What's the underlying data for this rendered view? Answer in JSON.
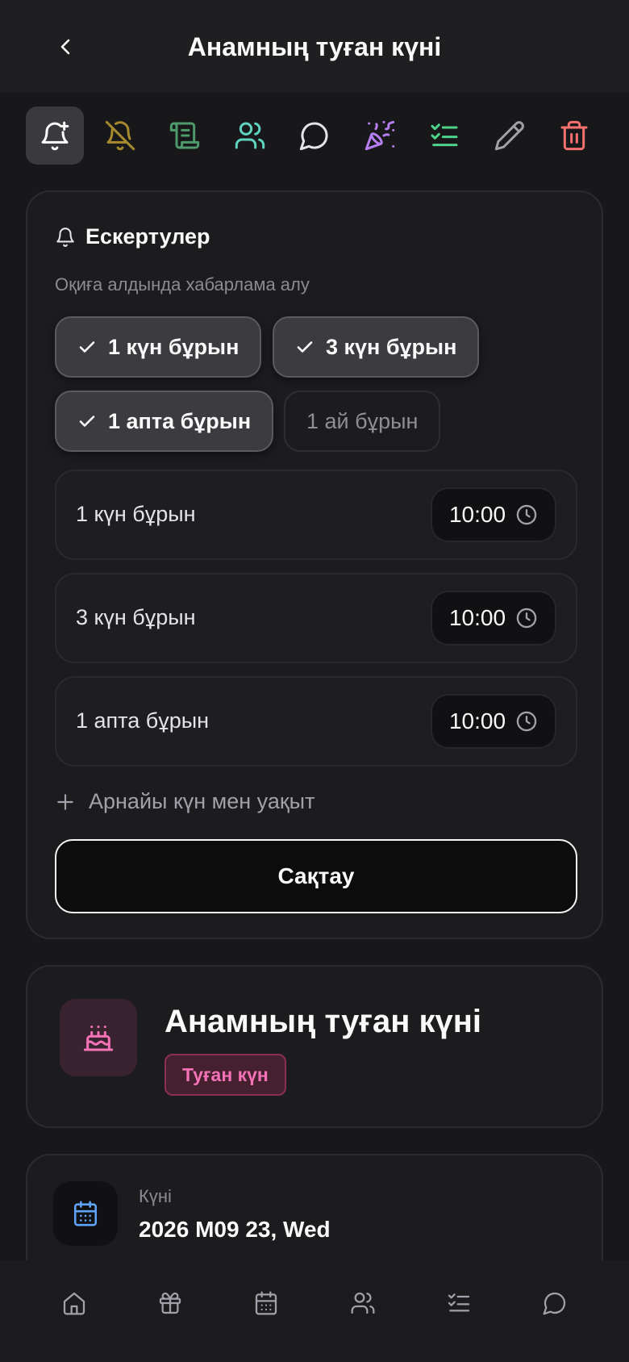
{
  "header": {
    "title": "Анамның туған күні",
    "back_icon": "chevron-left-icon"
  },
  "toolbar": {
    "tools": [
      {
        "name": "bell-plus-icon",
        "color": "#ffffff",
        "active": true
      },
      {
        "name": "bell-off-icon",
        "color": "#a88a2e"
      },
      {
        "name": "scroll-icon",
        "color": "#4e9a6a"
      },
      {
        "name": "users-icon",
        "color": "#5fd3c0"
      },
      {
        "name": "chat-icon",
        "color": "#e4e4e7"
      },
      {
        "name": "party-popper-icon",
        "color": "#b67ef0"
      },
      {
        "name": "checklist-icon",
        "color": "#4ed38a"
      },
      {
        "name": "pencil-icon",
        "color": "#a1a1aa"
      },
      {
        "name": "trash-icon",
        "color": "#f87171"
      }
    ]
  },
  "reminders": {
    "title": "Ескертулер",
    "subtitle": "Оқиға алдында хабарлама алу",
    "chips": [
      {
        "label": "1 күн бұрын",
        "selected": true
      },
      {
        "label": "3 күн бұрын",
        "selected": true
      },
      {
        "label": "1 апта бұрын",
        "selected": true
      },
      {
        "label": "1 ай бұрын",
        "selected": false
      }
    ],
    "rows": [
      {
        "label": "1 күн бұрын",
        "time": "10:00"
      },
      {
        "label": "3 күн бұрын",
        "time": "10:00"
      },
      {
        "label": "1 апта бұрын",
        "time": "10:00"
      }
    ],
    "add_custom": "Арнайы күн мен уақыт",
    "save": "Сақтау"
  },
  "event": {
    "title": "Анамның туған күні",
    "badge": "Туған күн",
    "icon": "cake-icon",
    "accent": "#f472b6"
  },
  "date": {
    "label": "Күні",
    "value": "2026 M09 23, Wed",
    "icon": "calendar-icon",
    "accent": "#60a5fa"
  },
  "nav": {
    "items": [
      "home-icon",
      "gift-icon",
      "calendar-icon",
      "users-icon",
      "checklist-icon",
      "chat-icon"
    ]
  }
}
